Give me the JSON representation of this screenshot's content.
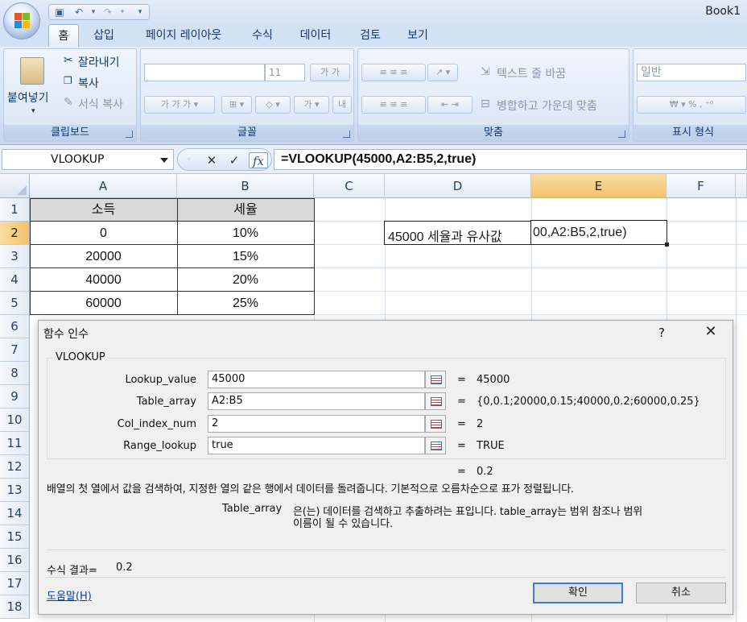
{
  "window": {
    "title": "Book1"
  },
  "quick_access": {
    "save_icon": "save-icon",
    "undo_icon": "undo-icon",
    "redo_icon": "redo-icon",
    "customize_icon": "customize-icon"
  },
  "tabs": [
    "홈",
    "삽입",
    "페이지 레이아웃",
    "수식",
    "데이터",
    "검토",
    "보기"
  ],
  "ribbon": {
    "clipboard": {
      "label": "클립보드",
      "paste": "붙여넣기",
      "cut": "잘라내기",
      "copy": "복사",
      "format_painter": "서식 복사"
    },
    "font": {
      "label": "글꼴",
      "font_name": "",
      "font_size": "11"
    },
    "alignment": {
      "label": "맞춤",
      "wrap_text": "텍스트 줄 바꿈",
      "merge_center": "병합하고 가운데 맞춤"
    },
    "number": {
      "label": "표시 형식",
      "format": "일반"
    }
  },
  "formula_bar": {
    "name_box": "VLOOKUP",
    "cancel": "✕",
    "enter": "✓",
    "fx": "fx",
    "formula": "=VLOOKUP(45000,A2:B5,2,true)"
  },
  "grid": {
    "columns": [
      "A",
      "B",
      "C",
      "D",
      "E",
      "F"
    ],
    "selected_column": "E",
    "rows": [
      "1",
      "2",
      "3",
      "4",
      "5",
      "6",
      "7",
      "8",
      "9",
      "10",
      "11",
      "12",
      "13",
      "14",
      "15",
      "16",
      "17",
      "18"
    ],
    "selected_row": "2",
    "table": {
      "headers": [
        "소득",
        "세율"
      ],
      "rows": [
        [
          "0",
          "10%"
        ],
        [
          "20000",
          "15%"
        ],
        [
          "40000",
          "20%"
        ],
        [
          "60000",
          "25%"
        ]
      ]
    },
    "d2_label": "45000 세율과 유사값",
    "e2_edit": "00,A2:B5,2,true)"
  },
  "dialog": {
    "title": "함수 인수",
    "help_button": "?",
    "close_button": "✕",
    "function_name": "VLOOKUP",
    "args": [
      {
        "label": "Lookup_value",
        "value": "45000",
        "result": "45000"
      },
      {
        "label": "Table_array",
        "value": "A2:B5",
        "result": "{0,0.1;20000,0.15;40000,0.2;60000,0.25}"
      },
      {
        "label": "Col_index_num",
        "value": "2",
        "result": "2"
      },
      {
        "label": "Range_lookup",
        "value": "true",
        "result": "TRUE"
      }
    ],
    "eq": "=",
    "function_result": "0.2",
    "description": "배열의 첫 열에서 값을 검색하여, 지정한 열의 같은 행에서 데이터를 돌려줍니다. 기본적으로 오름차순으로 표가 정렬됩니다.",
    "arg_help_name": "Table_array",
    "arg_help_line1": "은(는) 데이터를 검색하고 추출하려는 표입니다. table_array는 범위 참조나 범위",
    "arg_help_line2": "이름이 될 수 있습니다.",
    "formula_result_label": "수식 결과=",
    "formula_result_value": "0.2",
    "help_link": "도움말(H)",
    "ok": "확인",
    "cancel": "취소"
  }
}
